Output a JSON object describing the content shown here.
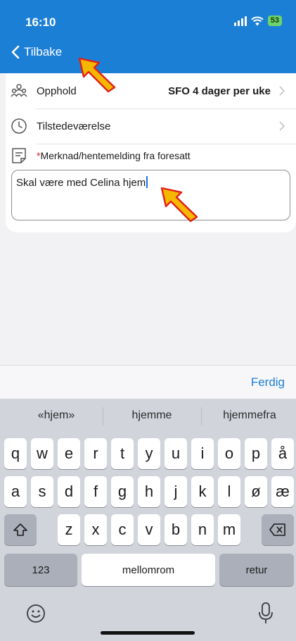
{
  "status_bar": {
    "time": "16:10",
    "battery": "53"
  },
  "nav": {
    "back_label": "Tilbake"
  },
  "form": {
    "stay_label": "Opphold",
    "stay_value": "SFO 4 dager per uke",
    "attendance_label": "Tilstedeværelse",
    "note_required_mark": "*",
    "note_label": "Merknad/hentemelding fra foresatt",
    "note_value": "Skal være med Celina hjem"
  },
  "accessory": {
    "done_label": "Ferdig"
  },
  "keyboard": {
    "predictions": [
      "«hjem»",
      "hjemme",
      "hjemmefra"
    ],
    "row1": [
      "q",
      "w",
      "e",
      "r",
      "t",
      "y",
      "u",
      "i",
      "o",
      "p",
      "å"
    ],
    "row2": [
      "a",
      "s",
      "d",
      "f",
      "g",
      "h",
      "j",
      "k",
      "l",
      "ø",
      "æ"
    ],
    "row3": [
      "z",
      "x",
      "c",
      "v",
      "b",
      "n",
      "m"
    ],
    "numbers_label": "123",
    "space_label": "mellomrom",
    "return_label": "retur"
  },
  "colors": {
    "header": "#1c7fd6",
    "accent": "#1c7fd6",
    "required": "#e02020",
    "pointer": "#f5b800"
  },
  "icons": [
    "chevron-left-icon",
    "group-icon",
    "clock-icon",
    "note-icon",
    "chevron-right-icon",
    "shift-icon",
    "backspace-icon",
    "emoji-icon",
    "microphone-icon",
    "pointer-arrow-icon"
  ]
}
